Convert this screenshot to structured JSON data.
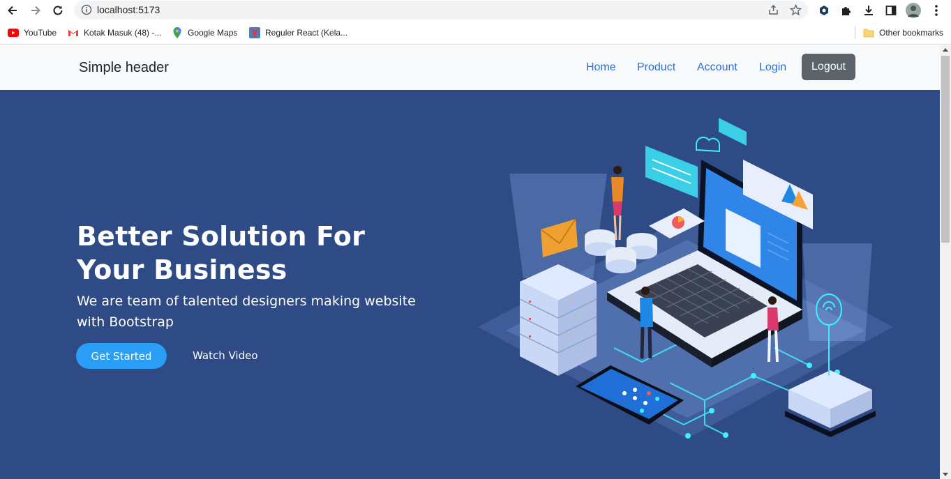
{
  "browser": {
    "url": "localhost:5173",
    "bookmarks": [
      {
        "label": "YouTube",
        "icon": "youtube-icon"
      },
      {
        "label": "Kotak Masuk (48) -...",
        "icon": "gmail-icon"
      },
      {
        "label": "Google Maps",
        "icon": "maps-icon"
      },
      {
        "label": "Reguler React (Kela...",
        "icon": "bookmark-favicon-icon"
      }
    ],
    "other_bookmarks": "Other bookmarks"
  },
  "header": {
    "brand": "Simple header",
    "nav": [
      "Home",
      "Product",
      "Account",
      "Login"
    ],
    "logout": "Logout"
  },
  "hero": {
    "title": "Better Solution For Your Business",
    "subtitle": "We are team of talented designers making website with Bootstrap",
    "cta_primary": "Get Started",
    "cta_secondary": "Watch Video"
  },
  "colors": {
    "hero_bg": "#2f4b86",
    "primary_button": "#2a9df4",
    "logout_button": "#5c636a",
    "nav_link": "#2a6fd6"
  }
}
